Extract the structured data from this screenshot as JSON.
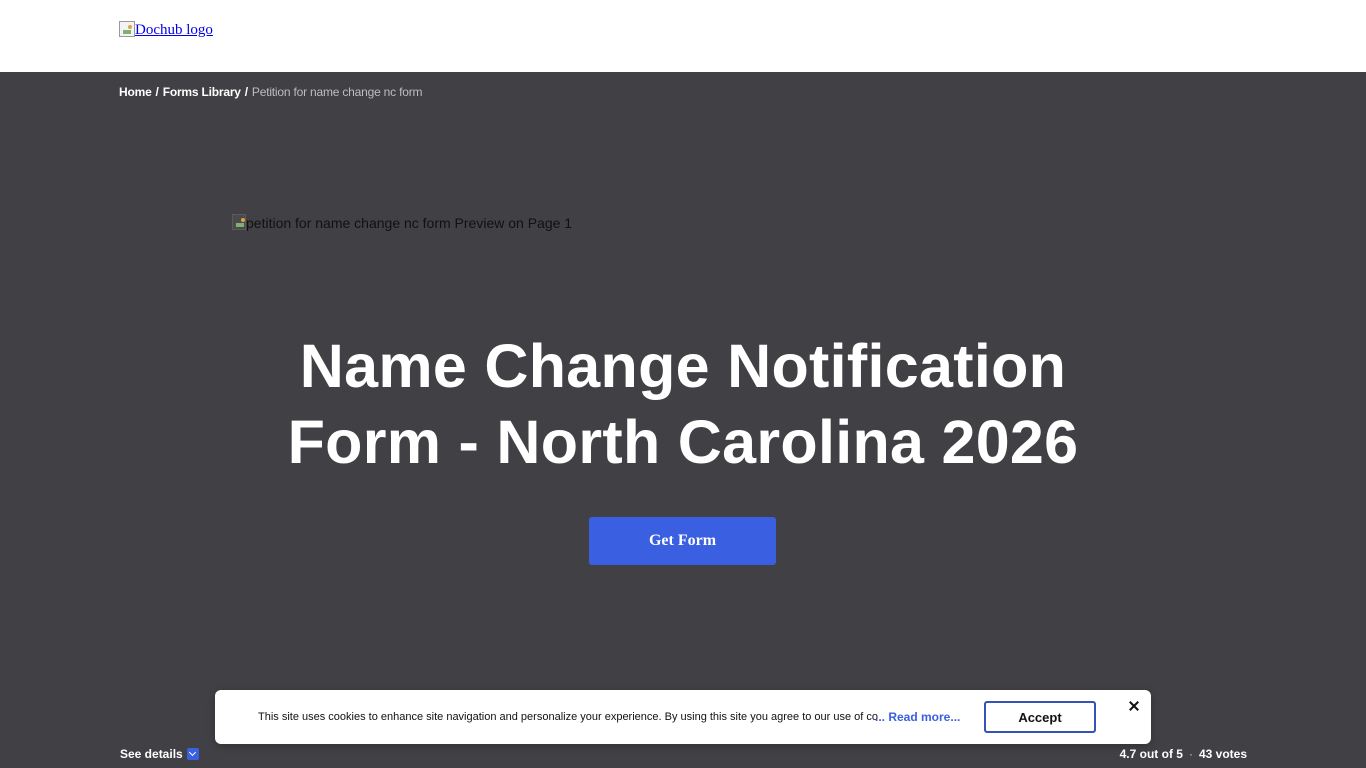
{
  "header": {
    "logo_alt": "Dochub logo"
  },
  "breadcrumb": {
    "home": "Home",
    "separator": "/",
    "forms_library": "Forms Library",
    "current": "Petition for name change nc form"
  },
  "preview": {
    "alt_text": "petition for name change nc form Preview on Page 1"
  },
  "hero": {
    "title_line1": "Name Change Notification",
    "title_line2": "Form - North Carolina 2026",
    "cta_label": "Get Form"
  },
  "footer_bar": {
    "see_details": "See details",
    "rating": "4.7 out of 5",
    "dot": "·",
    "votes": "43 votes"
  },
  "cookie_banner": {
    "text": "This site uses cookies to enhance site navigation and personalize your experience. By using this site you agree to our use of cookies.",
    "read_more": "... Read more...",
    "accept_label": "Accept"
  },
  "colors": {
    "background": "#414044",
    "accent": "#3a5fe0",
    "header_bg": "#ffffff"
  },
  "icons": {
    "broken_image": "broken-image-icon",
    "chevron": "chevron-down-icon",
    "close": "close-icon"
  }
}
